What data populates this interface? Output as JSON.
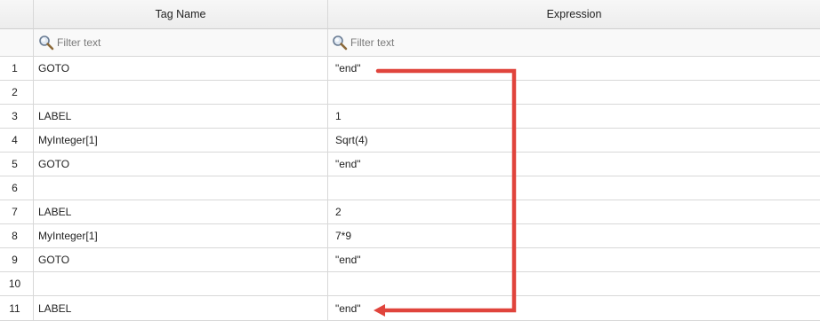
{
  "columns": {
    "tag_name": "Tag Name",
    "expression": "Expression"
  },
  "filter": {
    "tag_placeholder": "Filter text",
    "expression_placeholder": "Filter text",
    "icon": "magnifier-icon"
  },
  "rows": [
    {
      "num": "1",
      "tag": "GOTO",
      "expr": "\"end\""
    },
    {
      "num": "2",
      "tag": "",
      "expr": ""
    },
    {
      "num": "3",
      "tag": "LABEL",
      "expr": "1"
    },
    {
      "num": "4",
      "tag": "MyInteger[1]",
      "expr": "Sqrt(4)"
    },
    {
      "num": "5",
      "tag": "GOTO",
      "expr": "\"end\""
    },
    {
      "num": "6",
      "tag": "",
      "expr": ""
    },
    {
      "num": "7",
      "tag": "LABEL",
      "expr": "2"
    },
    {
      "num": "8",
      "tag": "MyInteger[1]",
      "expr": "7*9"
    },
    {
      "num": "9",
      "tag": "GOTO",
      "expr": "\"end\""
    },
    {
      "num": "10",
      "tag": "",
      "expr": ""
    },
    {
      "num": "11",
      "tag": "LABEL",
      "expr": "\"end\""
    }
  ],
  "annotation": {
    "color": "#e0443c",
    "from_row": "1",
    "to_row": "11"
  }
}
